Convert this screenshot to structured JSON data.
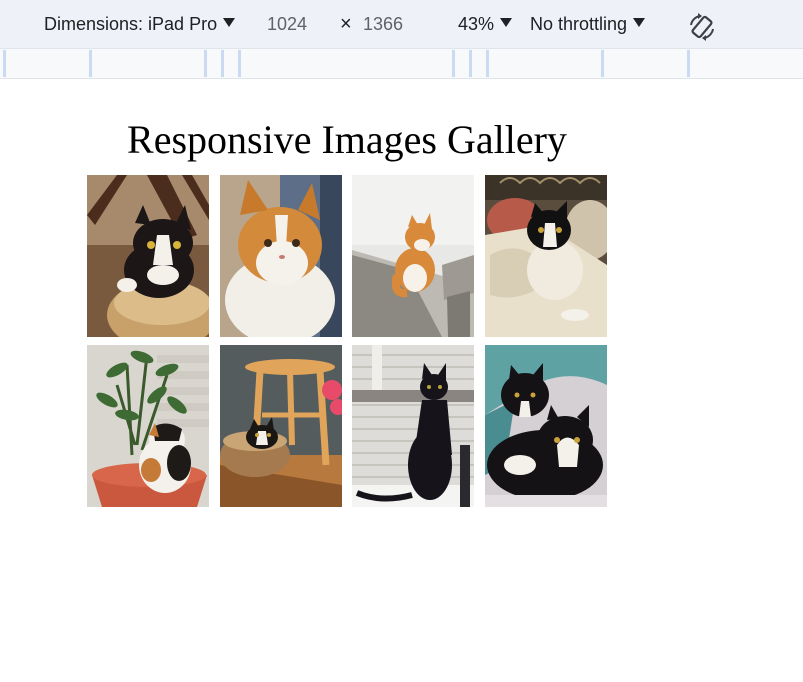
{
  "toolbar": {
    "dimensions_label": "Dimensions: iPad Pro",
    "width_value": "1024",
    "times_symbol": "×",
    "height_value": "1366",
    "zoom_label": "43%",
    "throttling_label": "No throttling",
    "rotate_icon": "rotate-device-icon"
  },
  "page": {
    "title": "Responsive Images Gallery"
  },
  "gallery": {
    "images": [
      {
        "subject": "tuxedo cat in knitted basket"
      },
      {
        "subject": "long-haired orange and white cat"
      },
      {
        "subject": "orange and white cat on stone bench"
      },
      {
        "subject": "black and white cat on pillows"
      },
      {
        "subject": "calico cat in plant pot"
      },
      {
        "subject": "tuxedo cat in basket under stool"
      },
      {
        "subject": "black cat sitting by brick wall"
      },
      {
        "subject": "two black and white cats under blanket"
      }
    ]
  }
}
